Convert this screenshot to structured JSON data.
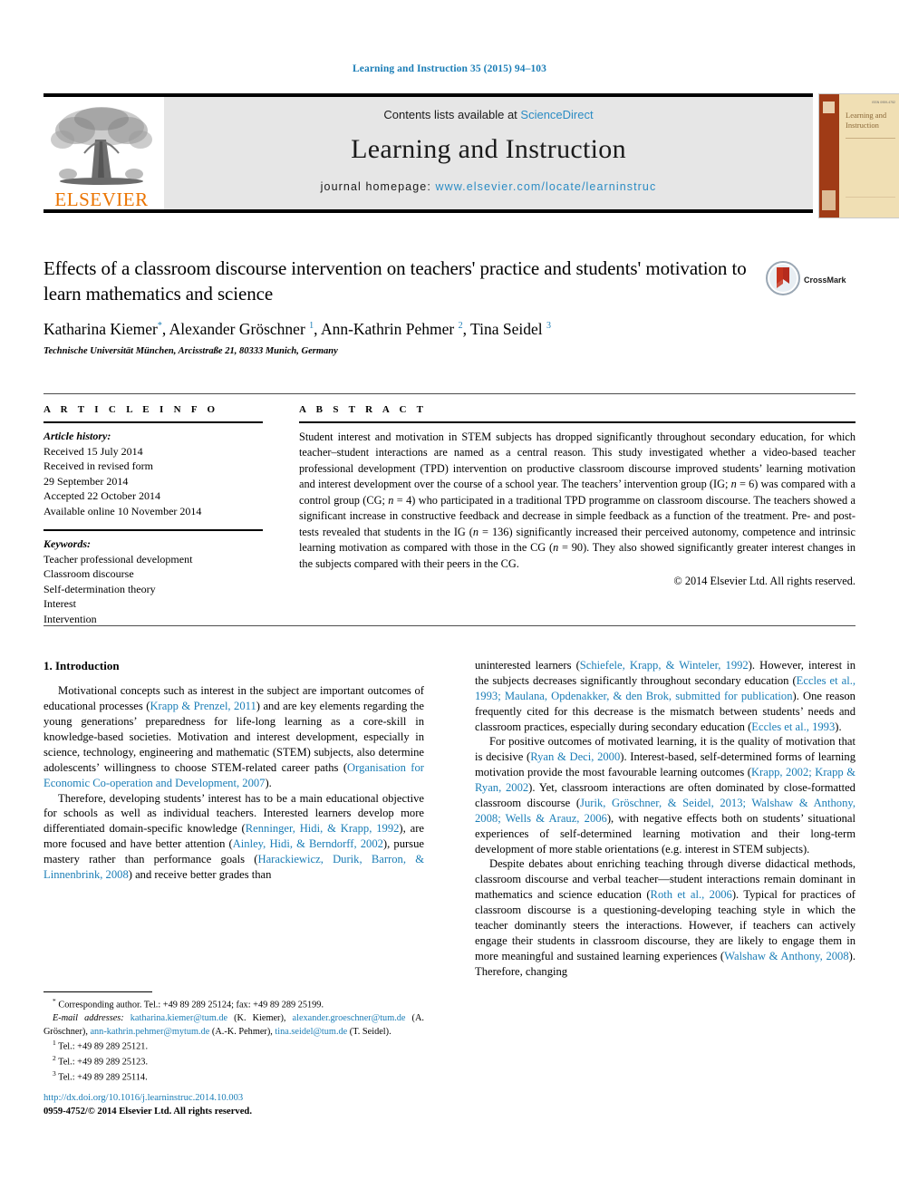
{
  "running_head": "Learning and Instruction 35 (2015) 94–103",
  "masthead": {
    "contents_prefix": "Contents lists available at ",
    "sciencedirect": "ScienceDirect",
    "journal_title": "Learning and Instruction",
    "homepage_prefix": "journal homepage: ",
    "homepage_url": "www.elsevier.com/locate/learninstruc",
    "publisher": "ELSEVIER",
    "cover": {
      "title": "Learning and Instruction",
      "tiny_top": "ISSN 0959-4752"
    }
  },
  "article": {
    "title": "Effects of a classroom discourse intervention on teachers' practice and students' motivation to learn mathematics and science",
    "authors_html": "Katharina Kiemer<sup>*</sup>, Alexander Gröschner <sup>1</sup>, Ann-Kathrin Pehmer <sup>2</sup>, Tina Seidel <sup>3</sup>",
    "affiliation": "Technische Universität München, Arcisstraße 21, 80333 Munich, Germany",
    "crossmark_label": "CrossMark"
  },
  "article_info": {
    "heading": "A R T I C L E  I N F O",
    "history_label": "Article history:",
    "history": [
      "Received 15 July 2014",
      "Received in revised form",
      "29 September 2014",
      "Accepted 22 October 2014",
      "Available online 10 November 2014"
    ],
    "keywords_label": "Keywords:",
    "keywords": [
      "Teacher professional development",
      "Classroom discourse",
      "Self-determination theory",
      "Interest",
      "Intervention"
    ]
  },
  "abstract": {
    "heading": "A B S T R A C T",
    "text_html": "Student interest and motivation in STEM subjects has dropped significantly throughout secondary education, for which teacher–student interactions are named as a central reason. This study investigated whether a video-based teacher professional development (TPD) intervention on productive classroom discourse improved students’ learning motivation and interest development over the course of a school year. The teachers’ intervention group (IG; <i>n</i> = 6) was compared with a control group (CG; <i>n</i> = 4) who participated in a traditional TPD programme on classroom discourse. The teachers showed a significant increase in constructive feedback and decrease in simple feedback as a function of the treatment. Pre- and post-tests revealed that students in the IG (<i>n</i> = 136) significantly increased their perceived autonomy, competence and intrinsic learning motivation as compared with those in the CG (<i>n</i> = 90). They also showed significantly greater interest changes in the subjects compared with their peers in the CG.",
    "copyright": "© 2014 Elsevier Ltd. All rights reserved."
  },
  "intro": {
    "heading": "1. Introduction",
    "left_paragraphs_html": [
      "Motivational concepts such as interest in the subject are important outcomes of educational processes (<span class=\"ref\">Krapp &amp; Prenzel, 2011</span>) and are key elements regarding the young generations’ preparedness for life-long learning as a core-skill in knowledge-based societies. Motivation and interest development, especially in science, technology, engineering and mathematic (STEM) subjects, also determine adolescents’ willingness to choose STEM-related career paths (<span class=\"ref\">Organisation for Economic Co-operation and Development, 2007</span>).",
      "Therefore, developing students’ interest has to be a main educational objective for schools as well as individual teachers. Interested learners develop more differentiated domain-specific knowledge (<span class=\"ref\">Renninger, Hidi, &amp; Krapp, 1992</span>), are more focused and have better attention (<span class=\"ref\">Ainley, Hidi, &amp; Berndorff, 2002</span>), pursue mastery rather than performance goals (<span class=\"ref\">Harackiewicz, Durik, Barron, &amp; Linnenbrink, 2008</span>) and receive better grades than"
    ],
    "right_paragraphs_html": [
      "uninterested learners (<span class=\"ref\">Schiefele, Krapp, &amp; Winteler, 1992</span>). However, interest in the subjects decreases significantly throughout secondary education (<span class=\"ref\">Eccles et al., 1993; Maulana, Opdenakker, &amp; den Brok, submitted for publication</span>). One reason frequently cited for this decrease is the mismatch between students’ needs and classroom practices, especially during secondary education (<span class=\"ref\">Eccles et al., 1993</span>).",
      "For positive outcomes of motivated learning, it is the quality of motivation that is decisive (<span class=\"ref\">Ryan &amp; Deci, 2000</span>). Interest-based, self-determined forms of learning motivation provide the most favourable learning outcomes (<span class=\"ref\">Krapp, 2002; Krapp &amp; Ryan, 2002</span>). Yet, classroom interactions are often dominated by close-formatted classroom discourse (<span class=\"ref\">Jurik, Gröschner, &amp; Seidel, 2013; Walshaw &amp; Anthony, 2008; Wells &amp; Arauz, 2006</span>), with negative effects both on students’ situational experiences of self-determined learning motivation and their long-term development of more stable orientations (e.g. interest in STEM subjects).",
      "Despite debates about enriching teaching through diverse didactical methods, classroom discourse and verbal teacher—student interactions remain dominant in mathematics and science education (<span class=\"ref\">Roth et al., 2006</span>). Typical for practices of classroom discourse is a questioning-developing teaching style in which the teacher dominantly steers the interactions. However, if teachers can actively engage their students in classroom discourse, they are likely to engage them in more meaningful and sustained learning experiences (<span class=\"ref\">Walshaw &amp; Anthony, 2008</span>). Therefore, changing"
    ]
  },
  "footnotes": {
    "corresponding_html": "<sup>*</sup> Corresponding author. Tel.: +49 89 289 25124; fax: +49 89 289 25199.",
    "emails_html": "<i>E-mail addresses:</i> <span class=\"mail\">katharina.kiemer@tum.de</span> (K. Kiemer), <span class=\"mail\">alexander.groeschner@tum.de</span> (A. Gröschner), <span class=\"mail\">ann-kathrin.pehmer@mytum.de</span> (A.-K. Pehmer), <span class=\"mail\">tina.seidel@tum.de</span> (T. Seidel).",
    "numbered_html": [
      "<sup>1</sup> Tel.: +49 89 289 25121.",
      "<sup>2</sup> Tel.: +49 89 289 25123.",
      "<sup>3</sup> Tel.: +49 89 289 25114."
    ]
  },
  "doi_block": {
    "doi": "http://dx.doi.org/10.1016/j.learninstruc.2014.10.003",
    "issn": "0959-4752/© 2014 Elsevier Ltd. All rights reserved."
  },
  "colors": {
    "link_blue": "#1a7db6",
    "sciencedirect_blue": "#2b8cc4",
    "elsevier_orange": "#eb7400",
    "band_gray": "#e6e6e6",
    "cover_spine": "#a03b16",
    "cover_body": "#f0dfb4"
  }
}
